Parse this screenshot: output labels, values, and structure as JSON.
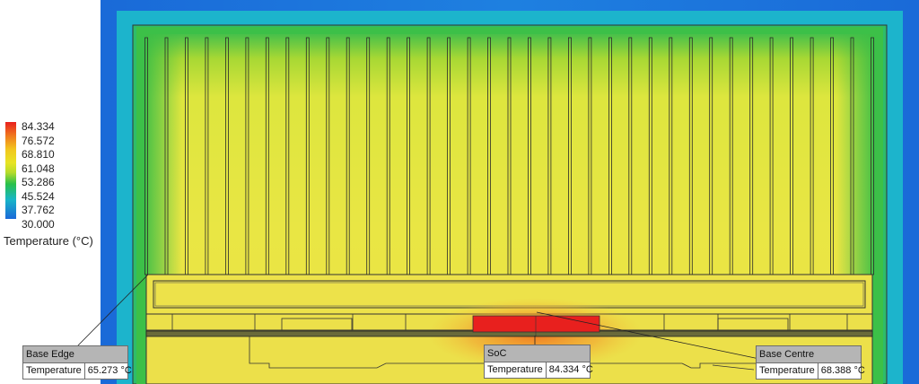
{
  "legend": {
    "title": "Temperature (°C)",
    "values": [
      "84.334",
      "76.572",
      "68.810",
      "61.048",
      "53.286",
      "45.524",
      "37.762",
      "30.000"
    ]
  },
  "probes": [
    {
      "title": "Base Edge",
      "label": "Temperature",
      "value": "65.273 °C"
    },
    {
      "title": "SoC",
      "label": "Temperature",
      "value": "84.334 °C"
    },
    {
      "title": "Base Centre",
      "label": "Temperature",
      "value": "68.388 °C"
    }
  ],
  "colors": {
    "hot": "#e8201e",
    "warm": "#f0c23a",
    "base_yellow": "#ede24c",
    "fin_yellow": "#e6e846",
    "green": "#3cbe46",
    "cyan": "#18b6c8",
    "blue": "#1a68d8",
    "line": "#222222"
  }
}
